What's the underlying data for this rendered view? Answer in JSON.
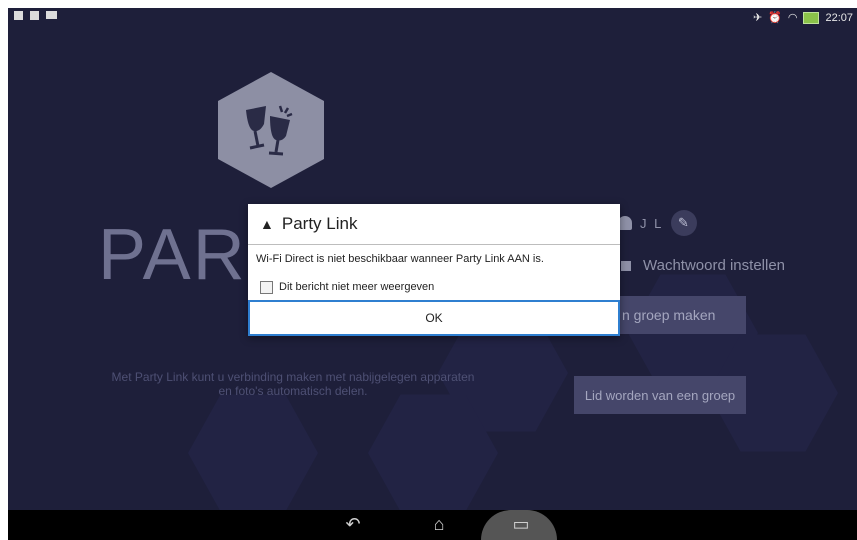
{
  "statusbar": {
    "time": "22:07",
    "left_icons": [
      "notification-icon",
      "document-icon",
      "calendar-icon"
    ],
    "right_icons": [
      "silent-icon",
      "alarm-icon",
      "wifi-icon",
      "battery-icon"
    ]
  },
  "app": {
    "title_visible": "PAR",
    "user_initials": "J L",
    "password_label": "Wachtwoord instellen",
    "create_group_label": "n groep maken",
    "join_group_label": "Lid worden van een groep",
    "description_line1": "Met Party Link kunt u verbinding maken met nabijgelegen apparaten",
    "description_line2": "en foto's automatisch delen."
  },
  "dialog": {
    "title": "Party Link",
    "message": "Wi-Fi Direct is niet beschikbaar wanneer Party Link AAN is.",
    "checkbox_label": "Dit bericht niet meer weergeven",
    "ok_label": "OK"
  },
  "colors": {
    "background": "#1e1f3a",
    "accent_border": "#2f7fd0",
    "battery": "#8bc34a"
  }
}
